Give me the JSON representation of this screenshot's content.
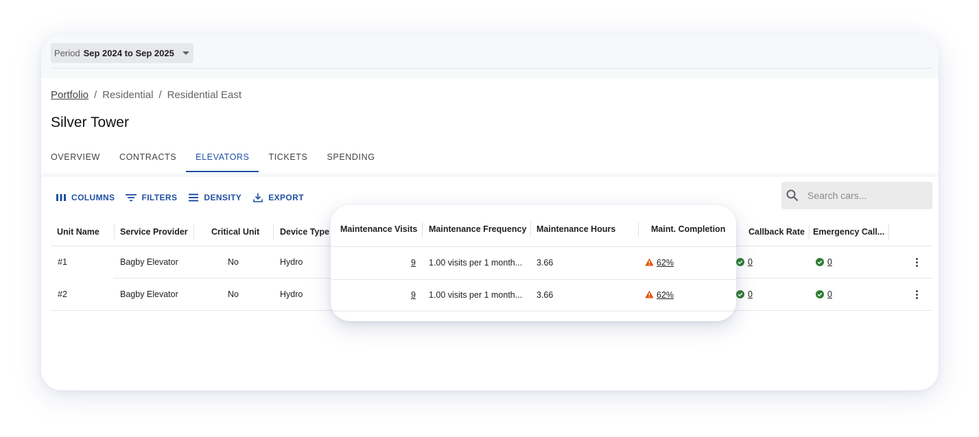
{
  "period": {
    "label": "Period",
    "value": "Sep 2024 to Sep 2025"
  },
  "breadcrumb": [
    {
      "label": "Portfolio"
    },
    {
      "label": "Residential"
    },
    {
      "label": "Residential East"
    }
  ],
  "breadcrumb_separator": "/",
  "page_title": "Silver Tower",
  "tabs": [
    {
      "label": "OVERVIEW"
    },
    {
      "label": "CONTRACTS"
    },
    {
      "label": "ELEVATORS"
    },
    {
      "label": "TICKETS"
    },
    {
      "label": "SPENDING"
    }
  ],
  "toolbar": {
    "columns": "COLUMNS",
    "filters": "FILTERS",
    "density": "DENSITY",
    "export": "EXPORT"
  },
  "search": {
    "placeholder": "Search cars..."
  },
  "table": {
    "headers": {
      "unit_name": "Unit Name",
      "service_provider": "Service Provider",
      "critical_unit": "Critical Unit",
      "device_type": "Device Type",
      "maintenance_visits": "Maintenance Visits",
      "maintenance_frequency": "Maintenance Frequency",
      "maintenance_hours": "Maintenance Hours",
      "maint_completion": "Maint. Completion",
      "callback_rate": "Callback Rate",
      "emergency_calls": "Emergency Call..."
    },
    "rows": [
      {
        "unit_name": "#1",
        "service_provider": "Bagby Elevator",
        "critical_unit": "No",
        "device_type": "Hydro",
        "maintenance_visits": "9",
        "maintenance_frequency": "1.00 visits per 1 month...",
        "maintenance_hours": "3.66",
        "maint_completion": "62%",
        "callback_rate": "0",
        "emergency_calls": "0"
      },
      {
        "unit_name": "#2",
        "service_provider": "Bagby Elevator",
        "critical_unit": "No",
        "device_type": "Hydro",
        "maintenance_visits": "9",
        "maintenance_frequency": "1.00 visits per 1 month...",
        "maintenance_hours": "3.66",
        "maint_completion": "62%",
        "callback_rate": "0",
        "emergency_calls": "0"
      }
    ]
  },
  "colors": {
    "accent": "#1f4fa3",
    "ok": "#2e7d32",
    "warning": "#e65100"
  }
}
